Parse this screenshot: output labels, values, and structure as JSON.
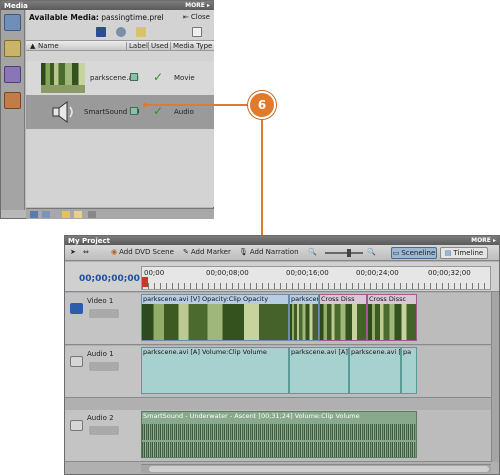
{
  "media_panel": {
    "header_title": "Media",
    "header_more": "MORE ▸",
    "available_label": "Available Media:",
    "project_file": "passingtime.prel",
    "close_label": "Close",
    "columns": [
      "Name",
      "Label",
      "Used",
      "Media Type"
    ],
    "items": [
      {
        "name": "parkscene.avi",
        "used": true,
        "type": "Movie"
      },
      {
        "name": "SmartSound - U",
        "used": true,
        "type": "Audio"
      }
    ]
  },
  "callout": {
    "number": "6",
    "color": "#e07a2c"
  },
  "project_panel": {
    "header_title": "My Project",
    "header_more": "MORE ▸",
    "toolbar": {
      "add_dvd_scene": "Add DVD Scene",
      "add_marker": "Add Marker",
      "add_narration": "Add Narration",
      "sceneline": "Sceneline",
      "timeline": "Timeline"
    },
    "timecode": "00;00;00;00",
    "ruler_ticks": [
      "00;00",
      "00;00;08;00",
      "00;00;16;00",
      "00;00;24;00",
      "00;00;32;00"
    ],
    "tracks": {
      "video1": {
        "name": "Video 1",
        "clips": [
          "parkscene.avi [V] Opacity:Clip Opacity",
          "parkscene",
          "Cross Diss",
          "Cross Dissc"
        ]
      },
      "audio1": {
        "name": "Audio 1",
        "clips": [
          "parkscene.avi [A] Volume:Clip Volume",
          "parkscene.avi [A]",
          "parkscene.avi [A]",
          "pa"
        ]
      },
      "audio2": {
        "name": "Audio 2",
        "clips": [
          "SmartSound - Underwater - Ascent [00;31;24] Volume:Clip Volume"
        ]
      }
    }
  }
}
